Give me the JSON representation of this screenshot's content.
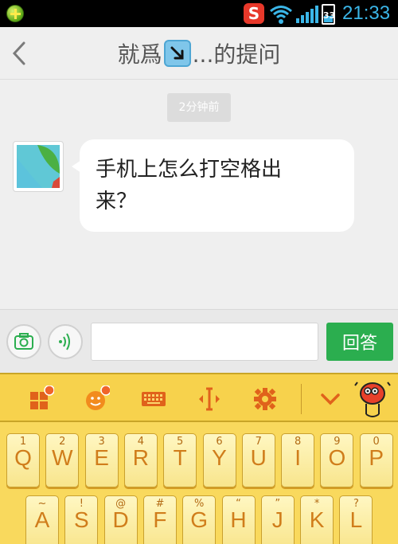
{
  "statusbar": {
    "battery_level": "33",
    "time": "21:33",
    "app_icon": "S"
  },
  "header": {
    "title_part1": "就爲",
    "title_part2": "...的提问"
  },
  "chat": {
    "timestamp": "2分钟前",
    "message_line1": "手机上怎么打空格出",
    "message_line2": "来？"
  },
  "input": {
    "value": "",
    "send_label": "回答"
  },
  "keyboard": {
    "row1": [
      {
        "sub": "1",
        "main": "Q"
      },
      {
        "sub": "2",
        "main": "W"
      },
      {
        "sub": "3",
        "main": "E"
      },
      {
        "sub": "4",
        "main": "R"
      },
      {
        "sub": "5",
        "main": "T"
      },
      {
        "sub": "6",
        "main": "Y"
      },
      {
        "sub": "7",
        "main": "U"
      },
      {
        "sub": "8",
        "main": "I"
      },
      {
        "sub": "9",
        "main": "O"
      },
      {
        "sub": "0",
        "main": "P"
      }
    ],
    "row2": [
      {
        "sub": "~",
        "main": "A"
      },
      {
        "sub": "!",
        "main": "S"
      },
      {
        "sub": "@",
        "main": "D"
      },
      {
        "sub": "#",
        "main": "F"
      },
      {
        "sub": "%",
        "main": "G"
      },
      {
        "sub": "“",
        "main": "H"
      },
      {
        "sub": "”",
        "main": "J"
      },
      {
        "sub": "*",
        "main": "K"
      },
      {
        "sub": "?",
        "main": "L"
      }
    ]
  },
  "colors": {
    "accent_green": "#2bae4f",
    "keyboard_yellow": "#f7d24c",
    "time_blue": "#3bb6e8"
  }
}
